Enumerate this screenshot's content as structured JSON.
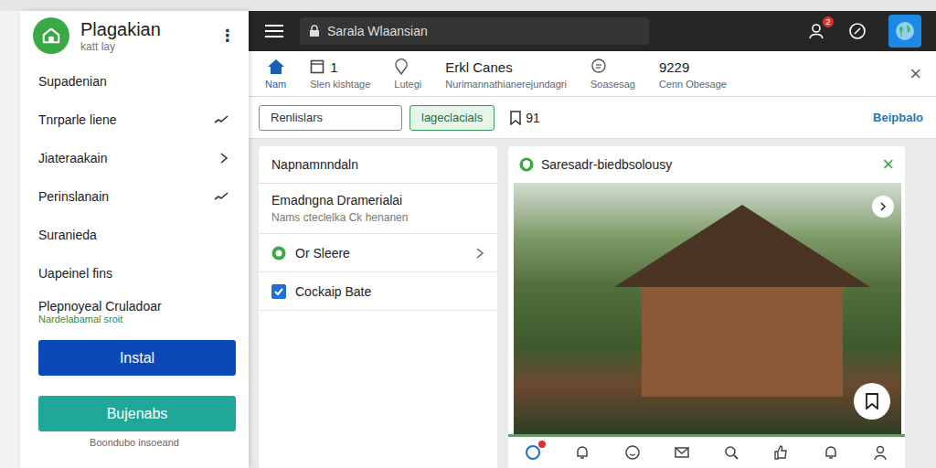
{
  "sidebar": {
    "title": "Plagakian",
    "subtitle": "katt lay",
    "menu_icon": "⋮",
    "items": [
      {
        "label": "Supadenian",
        "sub": "",
        "kind": "plain"
      },
      {
        "label": "Tnrparle liene",
        "sub": "",
        "kind": "trend"
      },
      {
        "label": "Jiateraakain",
        "sub": "",
        "kind": "chevron"
      },
      {
        "label": "Perinslanain",
        "sub": "",
        "kind": "trend"
      },
      {
        "label": "Suranieda",
        "sub": "",
        "kind": "plain"
      },
      {
        "label": "Uapeinel fins",
        "sub": "",
        "kind": "plain"
      },
      {
        "label": "Plepnoyeal Cruladoar",
        "sub": "Nardelabamal sroit",
        "kind": "plain"
      }
    ],
    "buttons": [
      {
        "label": "Instal",
        "color": "#0b49b8"
      },
      {
        "label": "Bujenabs",
        "color": "#1fa89a"
      }
    ],
    "footer": "Boondubo insoeand"
  },
  "topbar": {
    "search": "Sarala Wlaansian",
    "badge": "2"
  },
  "nav": {
    "items": [
      {
        "kind": "home",
        "value": "",
        "label": "Nam",
        "selected": true
      },
      {
        "kind": "square",
        "value": "1",
        "label": "Slen kishtage",
        "selected": false
      },
      {
        "kind": "pin",
        "value": "",
        "label": "Lutegi",
        "selected": false
      },
      {
        "kind": "text",
        "value": "Erkl Canes",
        "label": "Nurimannathianerejundagri",
        "selected": false
      },
      {
        "kind": "chat",
        "value": "",
        "label": "Soasesag",
        "selected": false
      },
      {
        "kind": "text",
        "value": "9229",
        "label": "Cenn Obesage",
        "selected": false
      }
    ],
    "close": "×"
  },
  "filters": {
    "chips": [
      {
        "label": "Renlislars",
        "selected": false
      },
      {
        "label": "lageclacials",
        "selected": true
      }
    ],
    "bookmark_count": "91",
    "link": "Beipbalo"
  },
  "left_card": {
    "title": "Napnamnndaln",
    "rows": [
      {
        "kind": "text",
        "title": "Emadngna Dramerialai",
        "sub": "Nams cteclelka Ck henanen",
        "checked": false
      },
      {
        "kind": "radio",
        "title": "Or Sleere",
        "sub": "",
        "checked": false
      },
      {
        "kind": "checkbox",
        "title": "Cockaip Bate",
        "sub": "",
        "checked": true
      }
    ]
  },
  "photo_card": {
    "title": "Saresadr-biedbsolousy",
    "close": "×",
    "badge_shown": true
  }
}
